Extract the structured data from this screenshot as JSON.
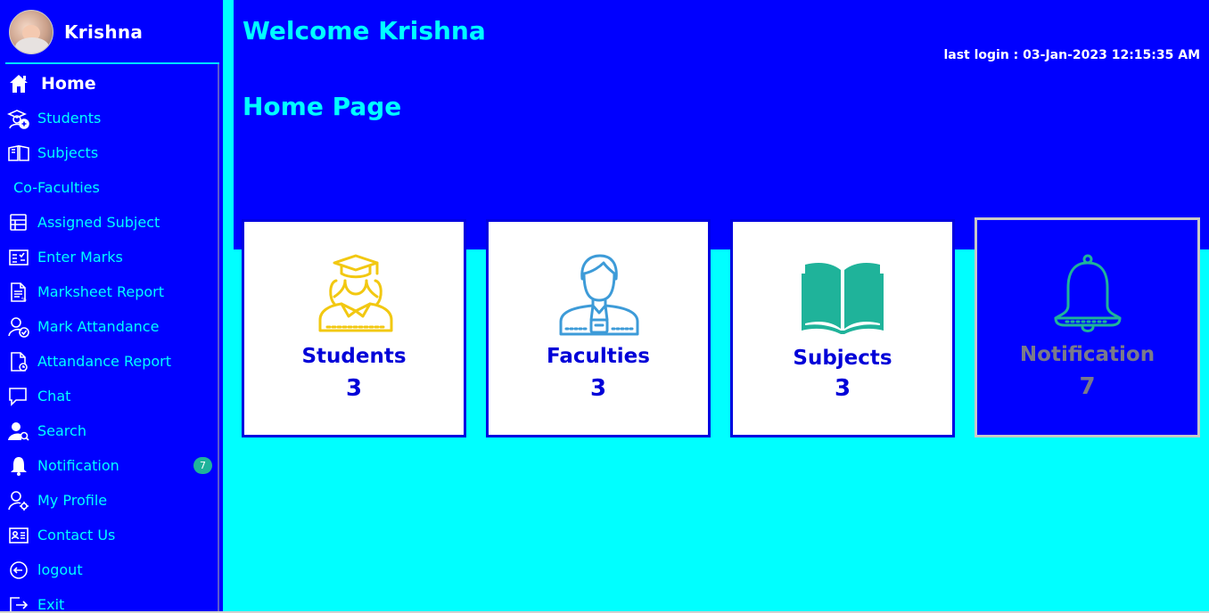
{
  "profile": {
    "name": "Krishna"
  },
  "sidebar": {
    "items": [
      {
        "label": "Home",
        "icon": "home-icon",
        "active": true
      },
      {
        "label": "Students",
        "icon": "students-icon"
      },
      {
        "label": "Subjects",
        "icon": "book-icon"
      },
      {
        "label": "Co-Faculties",
        "icon": ""
      },
      {
        "label": "Assigned Subject",
        "icon": "assigned-subject-icon"
      },
      {
        "label": "Enter Marks",
        "icon": "enter-marks-icon"
      },
      {
        "label": "Marksheet Report",
        "icon": "report-icon"
      },
      {
        "label": "Mark Attandance",
        "icon": "attendance-icon"
      },
      {
        "label": "Attandance Report",
        "icon": "attendance-report-icon"
      },
      {
        "label": "Chat",
        "icon": "chat-icon"
      },
      {
        "label": "Search",
        "icon": "search-user-icon"
      },
      {
        "label": "Notification",
        "icon": "bell-icon",
        "badge": "7"
      },
      {
        "label": "My Profile",
        "icon": "profile-settings-icon"
      },
      {
        "label": "Contact Us",
        "icon": "contact-card-icon"
      },
      {
        "label": "logout",
        "icon": "logout-icon"
      },
      {
        "label": "Exit",
        "icon": "exit-icon"
      }
    ]
  },
  "header": {
    "welcome": "Welcome Krishna",
    "last_login": "last login : 03-Jan-2023 12:15:35 AM",
    "page_title": "Home Page"
  },
  "cards": [
    {
      "title": "Students",
      "count": "3",
      "icon": "students-graduate-icon",
      "color": "#f2c811"
    },
    {
      "title": "Faculties",
      "count": "3",
      "icon": "faculty-icon",
      "color": "#3d9bd8"
    },
    {
      "title": "Subjects",
      "count": "3",
      "icon": "open-book-icon",
      "color": "#1fb39a"
    },
    {
      "title": "Notification",
      "count": "7",
      "icon": "bell-icon",
      "color": "#1fb39a"
    }
  ],
  "colors": {
    "primary_blue": "#0000ff",
    "accent_cyan": "#00ffff",
    "badge": "#1fb39a"
  }
}
